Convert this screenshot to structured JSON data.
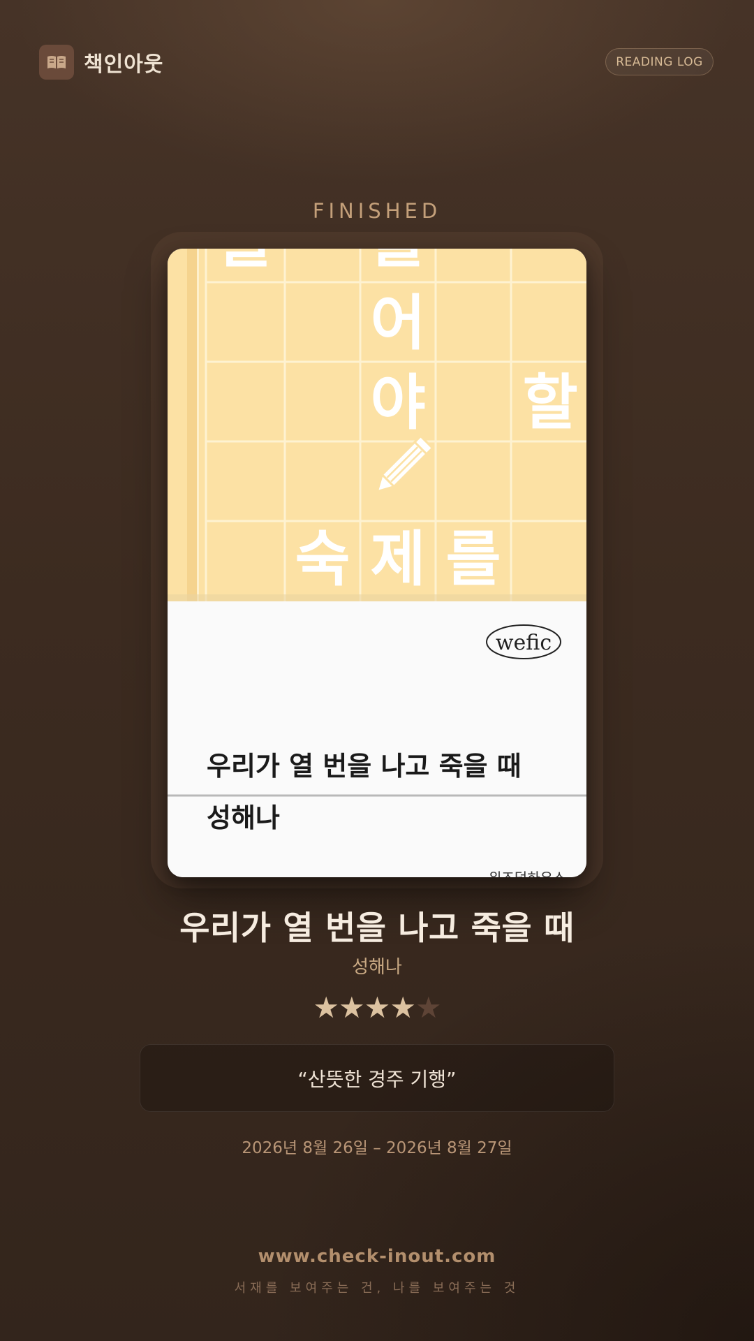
{
  "app": {
    "name": "책인아웃",
    "logo_icon": "open-book-icon"
  },
  "header": {
    "reading_log_label": "READING LOG"
  },
  "status": {
    "label": "FINISHED"
  },
  "cover": {
    "grid_glyphs": [
      "을",
      "를",
      "어",
      "야",
      "할",
      "숙",
      "제",
      "를"
    ],
    "pencil_icon": "pencil-icon",
    "publisher_logo": "wefic",
    "title": "우리가 열 번을 나고 죽을 때",
    "author": "성해나",
    "publisher_partial": "위즈덤하우스",
    "colors": {
      "top": "#fce1a4",
      "bottom": "#fafafa"
    }
  },
  "book": {
    "title": "우리가 열 번을 나고 죽을 때",
    "author": "성해나",
    "rating": 4,
    "rating_max": 5,
    "quote": "“산뜻한 경주 기행”",
    "dates": "2026년 8월 26일 – 2026년 8월 27일"
  },
  "footer": {
    "url": "www.check-inout.com",
    "tagline": "서재를 보여주는 건, 나를 보여주는 것"
  },
  "colors": {
    "accent": "#c4a07a",
    "background": "#3c2b20",
    "star_full": "#dcc2a0",
    "star_empty": "#5e4436"
  }
}
